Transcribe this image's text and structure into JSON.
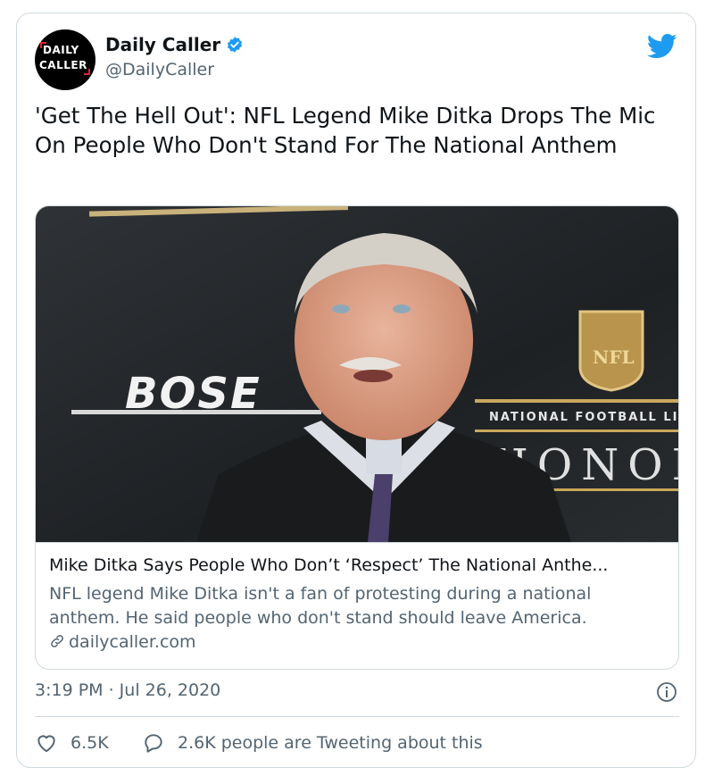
{
  "account": {
    "avatar_line1": "DAILY",
    "avatar_line2": "CALLER",
    "display_name": "Daily Caller",
    "handle": "@DailyCaller",
    "verified": true,
    "avatar_icon": "daily-caller-logo"
  },
  "platform_icon": "twitter-bird-icon",
  "tweet": {
    "text": "'Get The Hell Out': NFL Legend Mike Ditka Drops The Mic On People Who Don't Stand For The National Anthem"
  },
  "card": {
    "image_texts": {
      "sponsor": "BOSE",
      "banner": "NATIONAL FOOTBALL LI",
      "honors": "HONOR",
      "shield": "NFL"
    },
    "title": "Mike Ditka Says People Who Don’t ‘Respect’ The National Anthe...",
    "description": "NFL legend Mike Ditka isn't a fan of protesting during a national anthem. He said people who don't stand should leave America.",
    "domain": "dailycaller.com"
  },
  "meta": {
    "timestamp": "3:19 PM · Jul 26, 2020"
  },
  "actions": {
    "likes": "6.5K",
    "conversation": "2.6K people are Tweeting about this"
  },
  "colors": {
    "brand_blue": "#1d9bf0",
    "text_primary": "#0f1419",
    "text_secondary": "#536471",
    "border": "#cfd9de",
    "brand_red": "#e0242c"
  }
}
